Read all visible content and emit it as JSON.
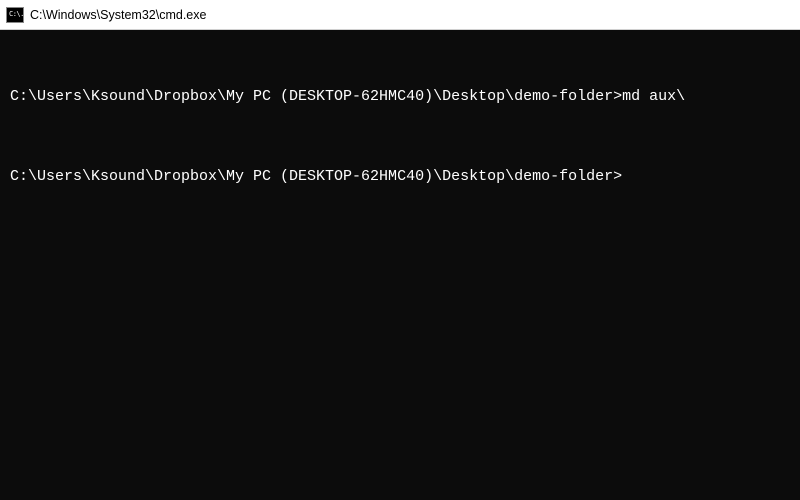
{
  "titlebar": {
    "icon_text": "C:\\.",
    "title": "C:\\Windows\\System32\\cmd.exe"
  },
  "terminal": {
    "lines": [
      {
        "prompt": "C:\\Users\\Ksound\\Dropbox\\My PC (DESKTOP-62HMC40)\\Desktop\\demo-folder>",
        "command": "md aux\\"
      },
      {
        "prompt": "C:\\Users\\Ksound\\Dropbox\\My PC (DESKTOP-62HMC40)\\Desktop\\demo-folder>",
        "command": ""
      }
    ]
  }
}
